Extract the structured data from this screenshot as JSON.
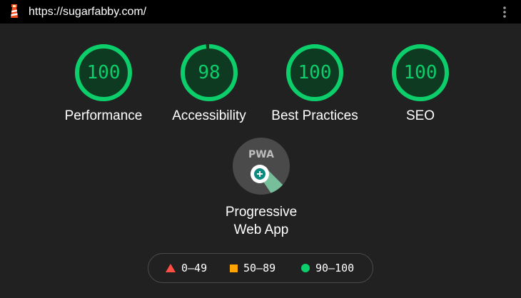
{
  "header": {
    "url": "https://sugarfabby.com/",
    "logo_icon": "lighthouse-icon",
    "menu_icon": "kebab-menu-icon"
  },
  "colors": {
    "pass": "#0cce6b",
    "pass_bg": "#0f3a22",
    "average": "#ffa400",
    "fail": "#ff4e42",
    "background": "#212121",
    "topbar": "#000000"
  },
  "scores": [
    {
      "id": "performance",
      "value": 100,
      "label": "Performance"
    },
    {
      "id": "accessibility",
      "value": 98,
      "label": "Accessibility"
    },
    {
      "id": "best-practices",
      "value": 100,
      "label": "Best Practices"
    },
    {
      "id": "seo",
      "value": 100,
      "label": "SEO"
    }
  ],
  "pwa": {
    "badge_text": "PWA",
    "label_line1": "Progressive",
    "label_line2": "Web App",
    "icon": "pwa-badge-icon"
  },
  "legend": [
    {
      "range": "0–49",
      "shape": "triangle-icon",
      "color": "#ff4e42"
    },
    {
      "range": "50–89",
      "shape": "square-icon",
      "color": "#ffa400"
    },
    {
      "range": "90–100",
      "shape": "circle-icon",
      "color": "#0cce6b"
    }
  ]
}
